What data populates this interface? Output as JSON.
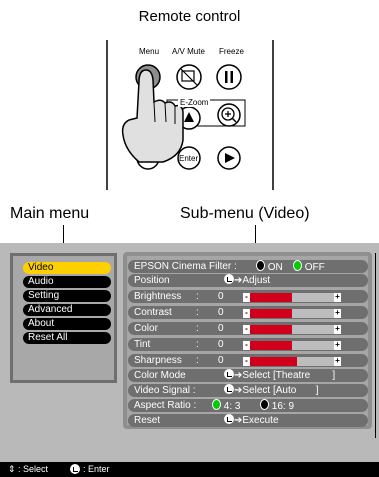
{
  "title": "Remote control",
  "remote": {
    "menu": "Menu",
    "av_mute": "A/V Mute",
    "freeze": "Freeze",
    "ezoom": "E-Zoom",
    "enter": "Enter"
  },
  "labels": {
    "main_menu": "Main menu",
    "sub_menu": "Sub-menu (Video)"
  },
  "main_menu": {
    "items": [
      {
        "label": "Video",
        "selected": true
      },
      {
        "label": "Audio"
      },
      {
        "label": "Setting"
      },
      {
        "label": "Advanced"
      },
      {
        "label": "About"
      },
      {
        "label": "Reset All"
      }
    ]
  },
  "sub_menu": {
    "cinema_filter_label": "EPSON Cinema Filter :",
    "cinema_on": "ON",
    "cinema_off": "OFF",
    "position_label": "Position",
    "position_value": "Adjust",
    "brightness_label": "Brightness",
    "brightness_value": "0",
    "contrast_label": "Contrast",
    "contrast_value": "0",
    "color_label": "Color",
    "color_value": "0",
    "tint_label": "Tint",
    "tint_value": "0",
    "sharpness_label": "Sharpness",
    "sharpness_value": "0",
    "colormode_label": "Color Mode",
    "colormode_value": "Select [Theatre        ]",
    "videosignal_label": "Video Signal :",
    "videosignal_value": "Select [Auto       ]",
    "aspect_label": "Aspect Ratio :",
    "aspect_43": "4: 3",
    "aspect_169": "16: 9",
    "reset_label": "Reset",
    "reset_value": "Execute",
    "sliders": {
      "brightness": 0.5,
      "contrast": 0.5,
      "color": 0.5,
      "tint": 0.5,
      "sharpness": 0.55
    }
  },
  "footer": {
    "select": ": Select",
    "enter": ": Enter"
  },
  "colors": {
    "selected_menu": "#ffd000",
    "slider_fill": "#d0001c",
    "osd_background": "#b9b9b9"
  }
}
